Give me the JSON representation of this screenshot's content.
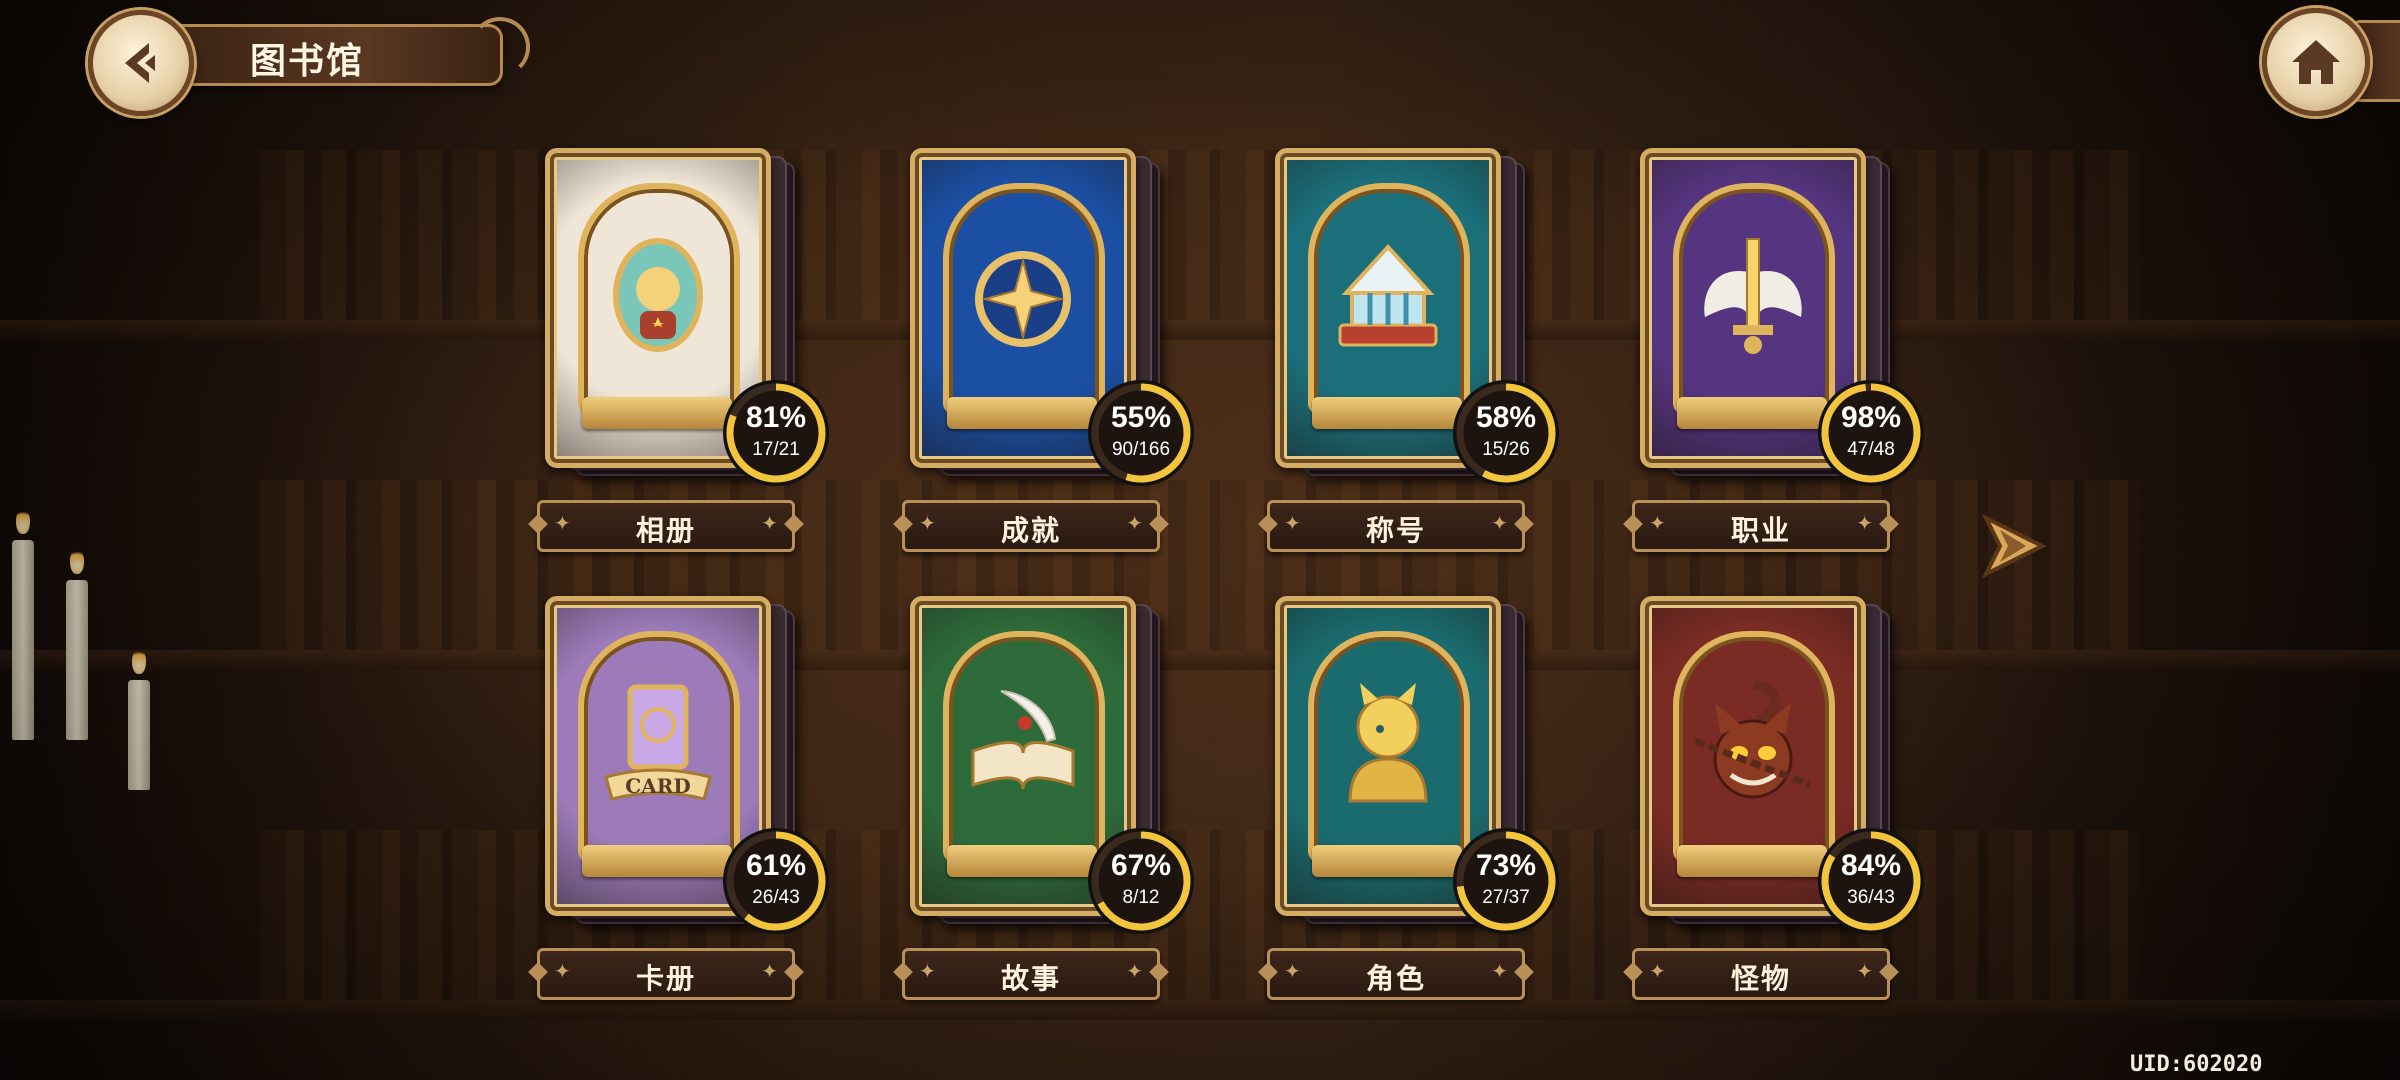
{
  "header": {
    "title": "图书馆"
  },
  "icons": {
    "back": "back-arrow-icon",
    "home": "home-icon",
    "next": "next-arrow-icon"
  },
  "colors": {
    "ring": "#f2c53d",
    "label_border": "#b89058",
    "text": "#fff3de"
  },
  "books": [
    {
      "label": "相册",
      "percent": "81%",
      "fraction": "17/21",
      "progress": 0.81,
      "cover": "#efe6d8",
      "accent": "#e0b45c",
      "icon": "portrait-icon"
    },
    {
      "label": "成就",
      "percent": "55%",
      "fraction": "90/166",
      "progress": 0.55,
      "cover": "#1b4fa3",
      "accent": "#e0b45c",
      "icon": "star-medal-icon"
    },
    {
      "label": "称号",
      "percent": "58%",
      "fraction": "15/26",
      "progress": 0.58,
      "cover": "#1b6f7a",
      "accent": "#e0b45c",
      "icon": "circus-tent-icon"
    },
    {
      "label": "职业",
      "percent": "98%",
      "fraction": "47/48",
      "progress": 0.98,
      "cover": "#55357f",
      "accent": "#e0b45c",
      "icon": "winged-sword-icon"
    },
    {
      "label": "卡册",
      "percent": "61%",
      "fraction": "26/43",
      "progress": 0.61,
      "cover": "#9c7bb8",
      "accent": "#e0b45c",
      "icon": "card-icon"
    },
    {
      "label": "故事",
      "percent": "67%",
      "fraction": "8/12",
      "progress": 0.67,
      "cover": "#2e6b3b",
      "accent": "#e0b45c",
      "icon": "open-book-quill-icon"
    },
    {
      "label": "角色",
      "percent": "73%",
      "fraction": "27/37",
      "progress": 0.73,
      "cover": "#1a6b6e",
      "accent": "#e0b45c",
      "icon": "character-bust-icon"
    },
    {
      "label": "怪物",
      "percent": "84%",
      "fraction": "36/43",
      "progress": 0.84,
      "cover": "#7a2c24",
      "accent": "#e0b45c",
      "icon": "chained-cat-monster-icon"
    }
  ],
  "emblem_text": "CARD",
  "footer": {
    "uid": "UID:602020"
  }
}
